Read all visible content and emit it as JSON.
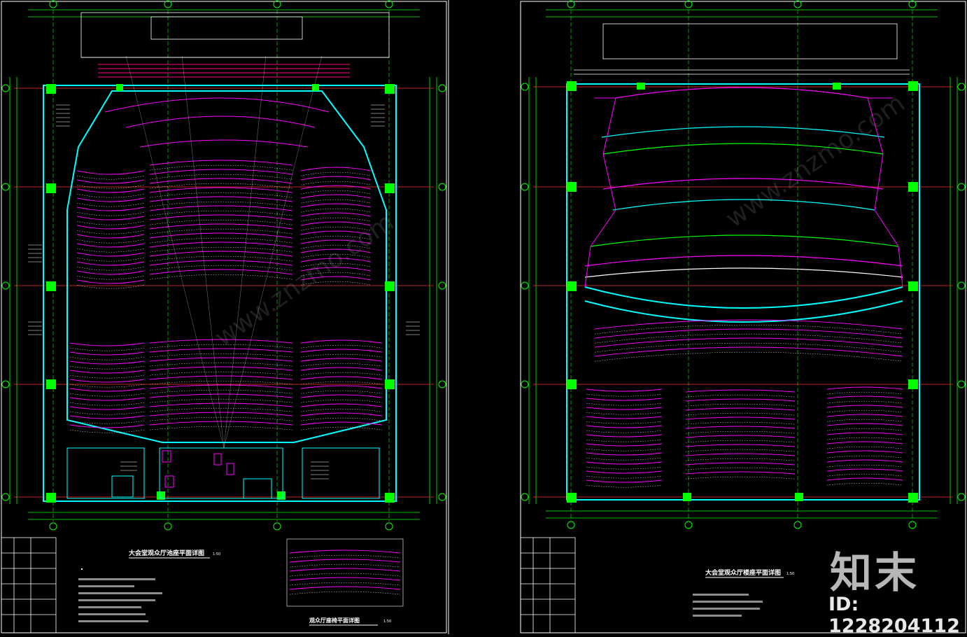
{
  "sheets": {
    "left": {
      "title": "大会堂观众厅池座平面详图",
      "scale": "1:50",
      "detail_title": "观众厅座椅平面详图",
      "detail_scale": "1:50"
    },
    "right": {
      "title": "大会堂观众厅楼座平面详图",
      "scale": "1:50"
    }
  },
  "watermark": {
    "logo": "知末",
    "id": "ID: 1228204112",
    "diagonal": "www.znzmo.com"
  },
  "colors": {
    "background": "#000000",
    "grid": "#00ff00",
    "wall": "#00ffff",
    "seat": "#ff00ff",
    "axis": "#ff0000",
    "line": "#ffffff"
  }
}
